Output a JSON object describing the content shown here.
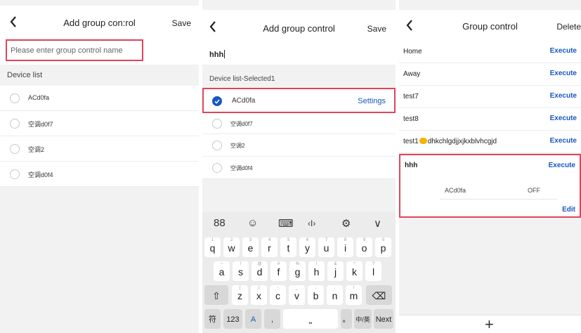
{
  "panel1": {
    "title": "Add group con:rol",
    "save_label": "Save",
    "name_placeholder": "Please enter group control name",
    "device_list_label": "Device list",
    "devices": [
      {
        "label": "ACd0fa"
      },
      {
        "label": "空调d0f7"
      },
      {
        "label": "空调2"
      },
      {
        "label": "空调d0f4"
      }
    ]
  },
  "panel2": {
    "title": "Add group control",
    "save_label": "Save",
    "name_value": "hhh",
    "device_list_label": "Device list-Selected1",
    "selected_device": "ACd0fa",
    "settings_label": "Settings",
    "devices": [
      {
        "label": "空调d0f7"
      },
      {
        "label": "空调2"
      },
      {
        "label": "空调d0f4"
      }
    ],
    "keyboard": {
      "tools": [
        "88",
        "☺",
        "⌨",
        "‹I›",
        "⚙",
        "∨"
      ],
      "row1": [
        [
          "q",
          "1"
        ],
        [
          "w",
          "2"
        ],
        [
          "e",
          "3"
        ],
        [
          "r",
          "4"
        ],
        [
          "t",
          "5"
        ],
        [
          "y",
          "6"
        ],
        [
          "u",
          "7"
        ],
        [
          "i",
          "8"
        ],
        [
          "o",
          "9"
        ],
        [
          "p",
          "0"
        ]
      ],
      "row2": [
        [
          "a",
          "~"
        ],
        [
          "s",
          "!"
        ],
        [
          "d",
          "@"
        ],
        [
          "f",
          "#"
        ],
        [
          "g",
          "%"
        ],
        [
          "h",
          "/"
        ],
        [
          "j",
          "&"
        ],
        [
          "k",
          "*"
        ],
        [
          "l",
          "?"
        ]
      ],
      "row3": [
        [
          "z",
          "("
        ],
        [
          "x",
          ")"
        ],
        [
          "c",
          "-"
        ],
        [
          "v",
          "_"
        ],
        [
          "b",
          ":"
        ],
        [
          "n",
          ";"
        ],
        [
          "m",
          "/"
        ]
      ],
      "shift_icon": "⇧",
      "delete_icon": "⌫",
      "bottom": {
        "symbols": "符",
        "numbers": "123",
        "lang_toggle": "A",
        "comma": ",",
        "space_icon": "⎵",
        "period": "。",
        "cn_en": "中/英",
        "next": "Next"
      }
    }
  },
  "panel3": {
    "title": "Group control",
    "delete_label": "Delete",
    "execute_label": "Execute",
    "groups": [
      {
        "name": "Home"
      },
      {
        "name": "Away"
      },
      {
        "name": "test7"
      },
      {
        "name": "test8"
      },
      {
        "name_prefix": "test1",
        "name_suffix": "dhkchlgdjjxjkxblvhcgjd"
      }
    ],
    "expanded_group": {
      "name": "hhh",
      "device": "ACd0fa",
      "state": "OFF",
      "edit_label": "Edit"
    },
    "add_icon": "+"
  },
  "colors": {
    "accent_blue": "#1757c2",
    "highlight_red": "#e0445a",
    "background": "#f2f2f2"
  }
}
